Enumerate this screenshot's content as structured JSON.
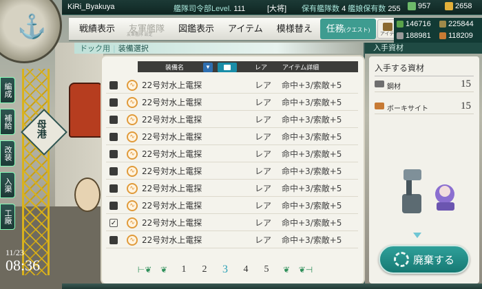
{
  "header": {
    "username": "KiRi_Byakuya",
    "hq_label": "艦隊司令部Level.",
    "hq_level": "111",
    "rank": "[大将]",
    "ships_label": "保有艦隊数",
    "fleets": "4",
    "ship_count_label": "艦娘保有数",
    "ship_count": "255",
    "top_res_1": "957",
    "top_res_2": "2658"
  },
  "resources": {
    "fuel": "146716",
    "ammo": "225844",
    "steel": "188981",
    "bauxite": "118209"
  },
  "nav": {
    "items": [
      {
        "label": "戦績表示"
      },
      {
        "label": "友軍艦隊",
        "sub": "友軍艦隊 設定"
      },
      {
        "label": "図鑑表示"
      },
      {
        "label": "アイテム"
      },
      {
        "label": "模様替え"
      },
      {
        "label": "任務",
        "suffix": "(クエスト)"
      }
    ],
    "item_shop_label": "アイテム屋"
  },
  "breadcrumb": {
    "parent": "ドック用",
    "current": "装備選択"
  },
  "list": {
    "col_name": "装備名",
    "col_rarity": "レア",
    "col_detail": "アイテム詳細",
    "rows": [
      {
        "name": "22号対水上電探",
        "rarity": "レア",
        "stat": "命中+3/索敵+5",
        "checked": false
      },
      {
        "name": "22号対水上電探",
        "rarity": "レア",
        "stat": "命中+3/索敵+5",
        "checked": false
      },
      {
        "name": "22号対水上電探",
        "rarity": "レア",
        "stat": "命中+3/索敵+5",
        "checked": false
      },
      {
        "name": "22号対水上電探",
        "rarity": "レア",
        "stat": "命中+3/索敵+5",
        "checked": false
      },
      {
        "name": "22号対水上電探",
        "rarity": "レア",
        "stat": "命中+3/索敵+5",
        "checked": false
      },
      {
        "name": "22号対水上電探",
        "rarity": "レア",
        "stat": "命中+3/索敵+5",
        "checked": false
      },
      {
        "name": "22号対水上電探",
        "rarity": "レア",
        "stat": "命中+3/索敵+5",
        "checked": false
      },
      {
        "name": "22号対水上電探",
        "rarity": "レア",
        "stat": "命中+3/索敵+5",
        "checked": false
      },
      {
        "name": "22号対水上電探",
        "rarity": "レア",
        "stat": "命中+3/索敵+5",
        "checked": true
      },
      {
        "name": "22号対水上電探",
        "rarity": "レア",
        "stat": "命中+3/索敵+5",
        "checked": false
      }
    ],
    "pages": [
      "1",
      "2",
      "3",
      "4",
      "5"
    ],
    "current_page": "3"
  },
  "obtain": {
    "tab": "入手資材",
    "title": "入手する資材",
    "steel_label": "鋼材",
    "steel_value": "15",
    "bauxite_label": "ボーキサイト",
    "bauxite_value": "15",
    "scrap_button": "廃棄する"
  },
  "side": {
    "tabs": [
      "編成",
      "補給",
      "改装",
      "入渠",
      "工廠"
    ],
    "port": "母港"
  },
  "clock": {
    "date": "11/23",
    "time": "08:36"
  },
  "colors": {
    "accent": "#3e9c90",
    "header_bg": "#1c3a36",
    "current_page": "#2aa0b6",
    "rating_orange": "#e09a3a"
  }
}
